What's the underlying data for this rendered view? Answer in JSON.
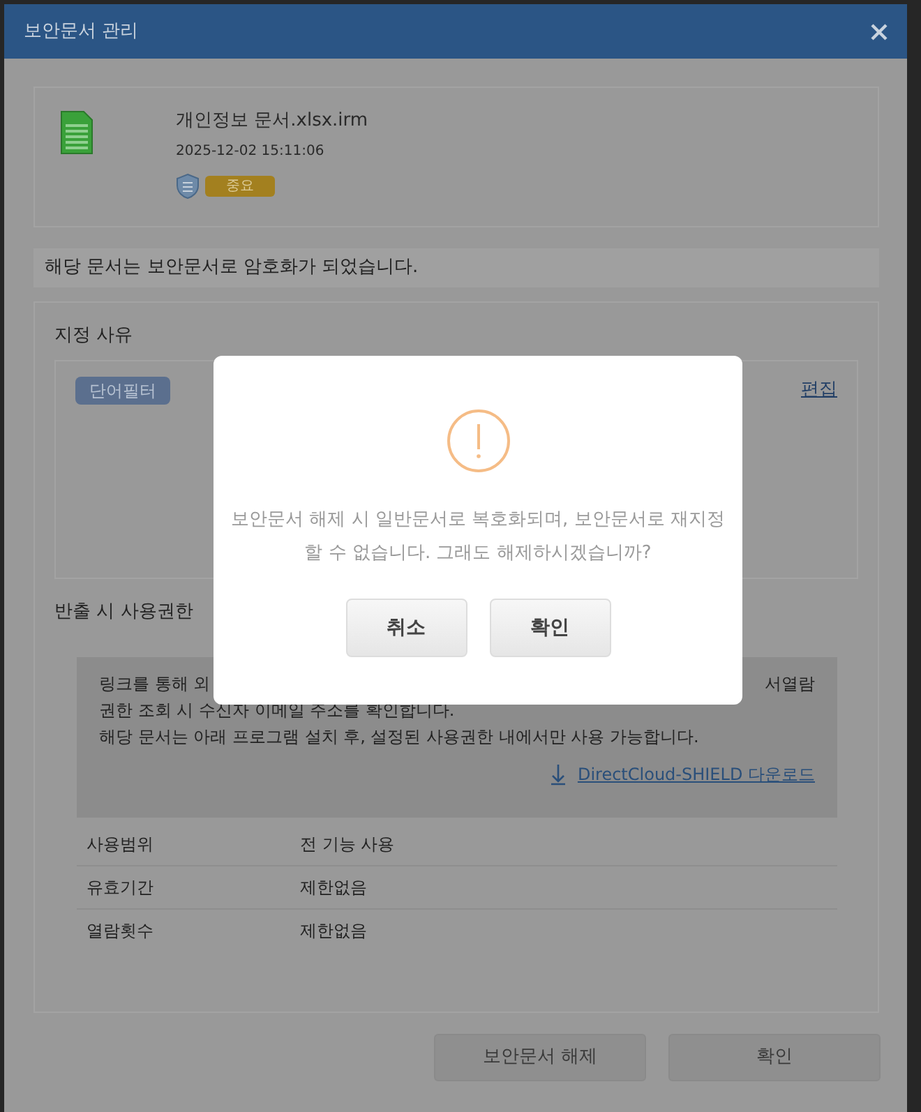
{
  "window": {
    "title": "보안문서 관리"
  },
  "file": {
    "name": "개인정보 문서.xlsx.irm",
    "date": "2025-12-02 15:11:06",
    "grade": "중요"
  },
  "message": "해당 문서는 보안문서로 암호화가 되었습니다.",
  "reason": {
    "heading": "지정 사유",
    "tags": [
      "단어필터"
    ],
    "edit_link": "편집"
  },
  "permissions": {
    "heading": "반출 시 사용권한",
    "line_1_start": "링크를 통해 외",
    "line_1_end": "서열람",
    "lines": [
      "권한 조회 시 수신자 이메일 주소를 확인합니다.",
      "해당 문서는 아래 프로그램 설치 후, 설정된 사용권한 내에서만 사용 가능합니다."
    ],
    "download_link": "DirectCloud-SHIELD 다운로드",
    "rows": [
      {
        "label": "사용범위",
        "value": "전 기능 사용"
      },
      {
        "label": "유효기간",
        "value": "제한없음"
      },
      {
        "label": "열람횟수",
        "value": "제한없음"
      }
    ]
  },
  "buttons": [
    "보안문서 해제",
    "확인"
  ],
  "alert": {
    "message": "보안문서 해제 시 일반문서로 복호화되며, 보안문서로 재지정할 수 없습니다. 그래도 해제하시겠습니까?",
    "buttons": [
      "취소",
      "확인"
    ]
  }
}
